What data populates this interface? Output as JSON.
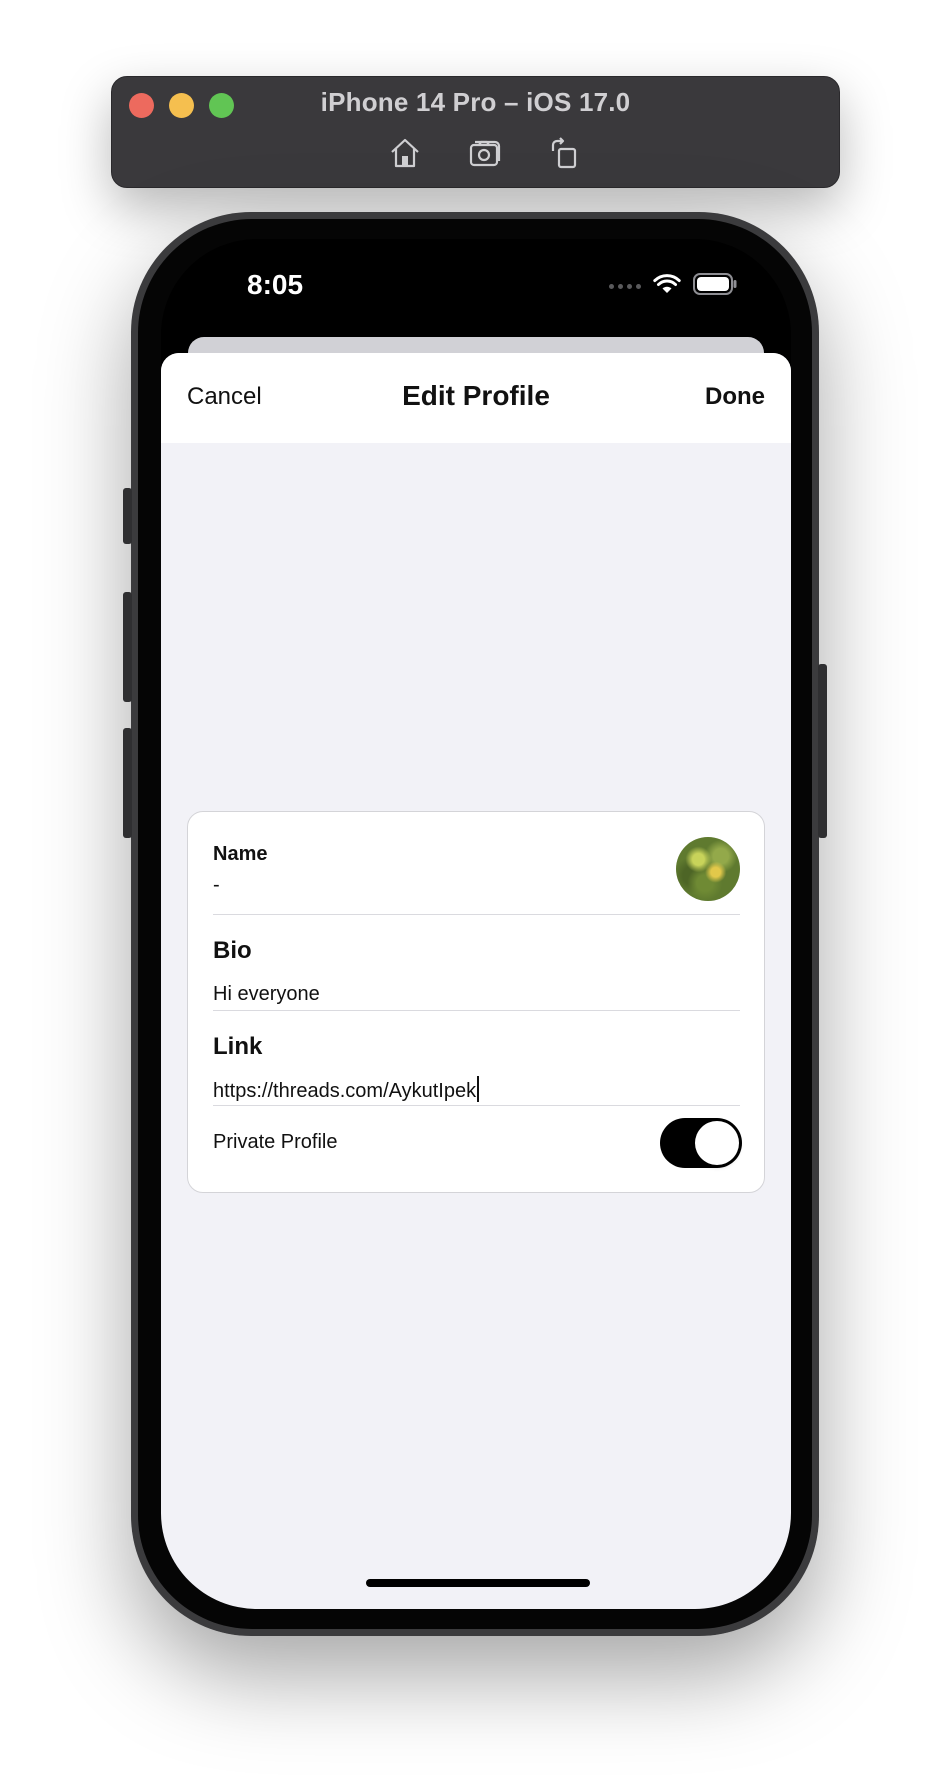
{
  "simulator": {
    "title": "iPhone 14 Pro – iOS 17.0",
    "toolbar": [
      "home-icon",
      "screenshot-icon",
      "rotate-icon"
    ]
  },
  "status_bar": {
    "time": "8:05"
  },
  "navbar": {
    "cancel_label": "Cancel",
    "title": "Edit Profile",
    "done_label": "Done"
  },
  "form": {
    "name": {
      "label": "Name",
      "value": "-"
    },
    "bio": {
      "label": "Bio",
      "value": "Hi everyone"
    },
    "link": {
      "label": "Link",
      "value": "https://threads.com/AykutIpek"
    },
    "private_profile": {
      "label": "Private Profile",
      "enabled": true
    }
  },
  "colors": {
    "sheet_background": "#f2f2f7",
    "toggle_on": "#000000",
    "simulator_bar": "#3a393c"
  }
}
